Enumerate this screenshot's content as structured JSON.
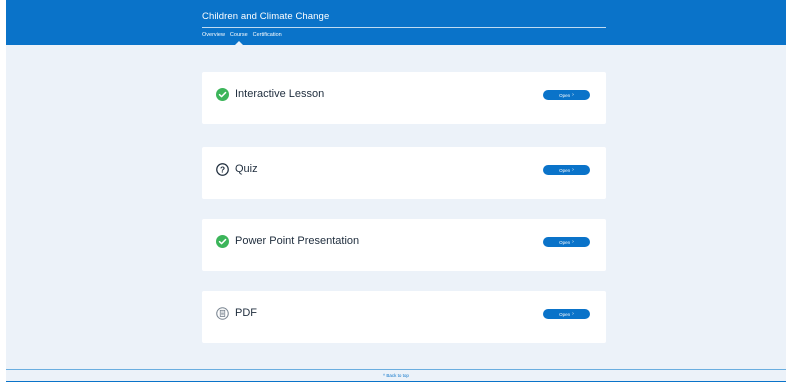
{
  "header": {
    "title": "Children and Climate Change",
    "nav": [
      {
        "label": "Overview"
      },
      {
        "label": "Course"
      },
      {
        "label": "Certification"
      }
    ],
    "active_tab": "Course"
  },
  "cards": [
    {
      "title": "Interactive Lesson",
      "icon": "check-circle-icon",
      "button_label": "Open",
      "button_icon": "chevron-right-icon"
    },
    {
      "title": "Quiz",
      "icon": "question-circle-icon",
      "button_label": "Open",
      "button_icon": "chevron-right-icon"
    },
    {
      "title": "Power Point Presentation",
      "icon": "check-circle-icon",
      "button_label": "Open",
      "button_icon": "chevron-right-icon"
    },
    {
      "title": "PDF",
      "icon": "document-circle-icon",
      "button_label": "Open",
      "button_icon": "chevron-right-icon"
    }
  ],
  "footer": {
    "back_to_top": "Back to top",
    "icon": "chevron-up-icon"
  },
  "colors": {
    "primary": "#0a73c9",
    "background": "#ecf2f9",
    "success": "#3cb55a",
    "text": "#1f2d3d"
  }
}
